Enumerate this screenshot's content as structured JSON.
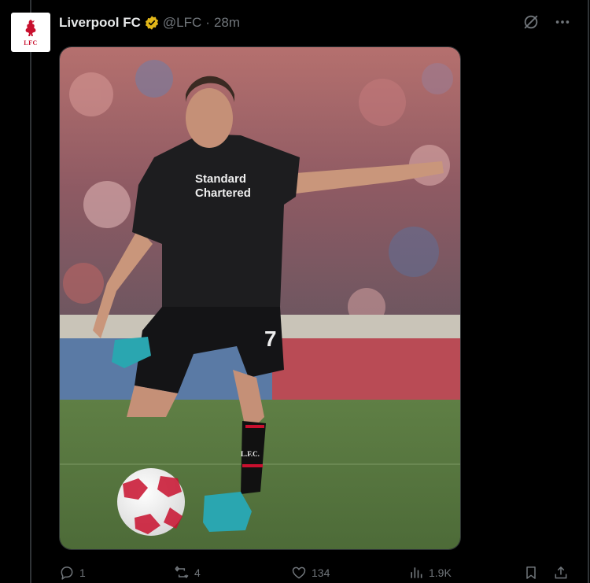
{
  "tweet": {
    "author_name": "Liverpool FC",
    "author_handle": "@LFC",
    "separator": "·",
    "timestamp": "28m",
    "avatar_text": "LFC",
    "media": {
      "alt_icon": "photo-football-player",
      "shirt_sponsor_line1": "Standard",
      "shirt_sponsor_line2": "Chartered",
      "shirt_number": "7",
      "sock_text": "L.F.C."
    }
  },
  "actions": {
    "reply_count": "1",
    "repost_count": "4",
    "like_count": "134",
    "views_count": "1.9K"
  },
  "colors": {
    "background": "#000000",
    "muted": "#71767b",
    "verified_gold": "#e2b719",
    "lfc_red": "#c8102e"
  }
}
